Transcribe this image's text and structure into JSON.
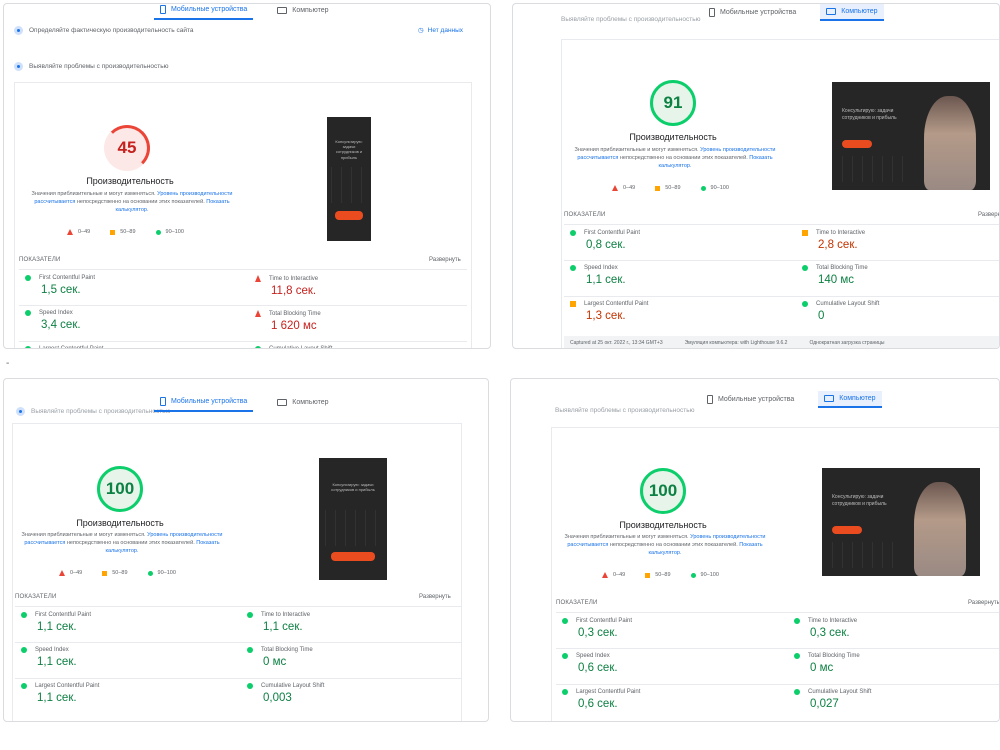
{
  "tabs": {
    "mobile": "Мобильные устройства",
    "desktop": "Компьютер"
  },
  "common": {
    "perf_label": "Производительность",
    "desc_pre": "Значения приблизительные и могут изменяться.",
    "desc_link1": "Уровень производительности рассчитывается",
    "desc_mid": "непосредственно на основании этих показателей.",
    "desc_link2": "Показать калькулятор.",
    "legend_red": "0–49",
    "legend_orange": "50–89",
    "legend_green": "90–100",
    "metrics_label": "ПОКАЗАТЕЛИ",
    "expand_label": "Развернуть",
    "m_fcp": "First Contentful Paint",
    "m_si": "Speed Index",
    "m_lcp": "Largest Contentful Paint",
    "m_tti": "Time to Interactive",
    "m_tbt": "Total Blocking Time",
    "m_cls": "Cumulative Layout Shift",
    "header_cut": "Выявляйте проблемы с производительностью",
    "shot_heading": "Консультирую: задачи сотрудников и прибыль",
    "shot_heading_desktop": "Консультирую: задачи сотрудников и прибыль"
  },
  "panel1": {
    "row1": "Определяйте фактическую производительность сайта",
    "nodata": "Нет данных",
    "row2": "Выявляйте проблемы с производительностью",
    "score": "45",
    "fcp": "1,5 сек.",
    "si": "3,4 сек.",
    "lcp": "",
    "tti": "11,8 сек.",
    "tbt": "1 620 мс"
  },
  "panel2": {
    "score": "91",
    "fcp": "0,8 сек.",
    "si": "1,1 сек.",
    "lcp": "1,3 сек.",
    "tti": "2,8 сек.",
    "tbt": "140 мс",
    "cls": "0",
    "footer1": "Captured at 25 окт. 2022 г., 13:34 GMT+3",
    "footer2": "Эмуляция компьютера: with Lighthouse 9.6.2",
    "footer3": "Однократная загрузка страницы"
  },
  "panel3": {
    "score": "100",
    "fcp": "1,1 сек.",
    "si": "1,1 сек.",
    "lcp": "1,1 сек.",
    "tti": "1,1 сек.",
    "tbt": "0 мс",
    "cls": "0,003"
  },
  "panel4": {
    "score": "100",
    "fcp": "0,3 сек.",
    "si": "0,6 сек.",
    "lcp": "0,6 сек.",
    "tti": "0,3 сек.",
    "tbt": "0 мс",
    "cls": "0,027"
  },
  "dash": "-",
  "colors": {
    "green": "#0cce6b",
    "red": "#eb4537",
    "orange": "#ffa400",
    "blue": "#1a73e8"
  }
}
